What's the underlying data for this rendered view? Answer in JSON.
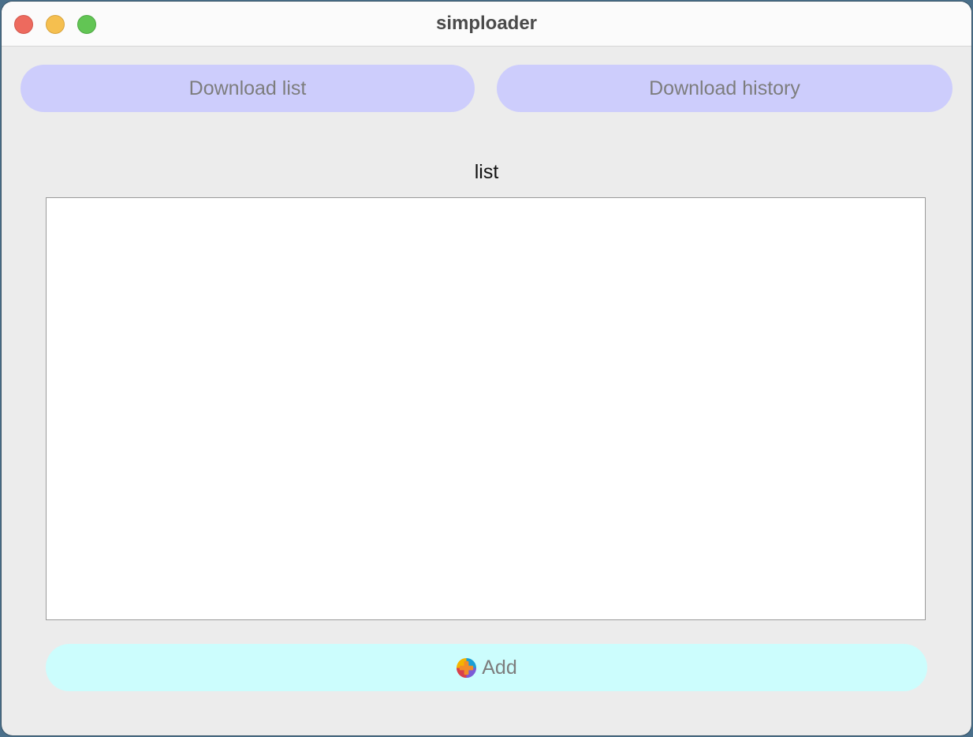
{
  "window": {
    "title": "simploader"
  },
  "tabs": {
    "download_list": "Download list",
    "download_history": "Download history"
  },
  "main": {
    "section_label": "list",
    "list_items": []
  },
  "actions": {
    "add_label": "Add",
    "add_icon": "plus-circle-icon"
  },
  "colors": {
    "tab_bg": "#cdcdfc",
    "add_bg": "#ccfdfd",
    "close": "#ed6a5e",
    "minimize": "#f5bf4f",
    "maximize": "#62c554"
  }
}
